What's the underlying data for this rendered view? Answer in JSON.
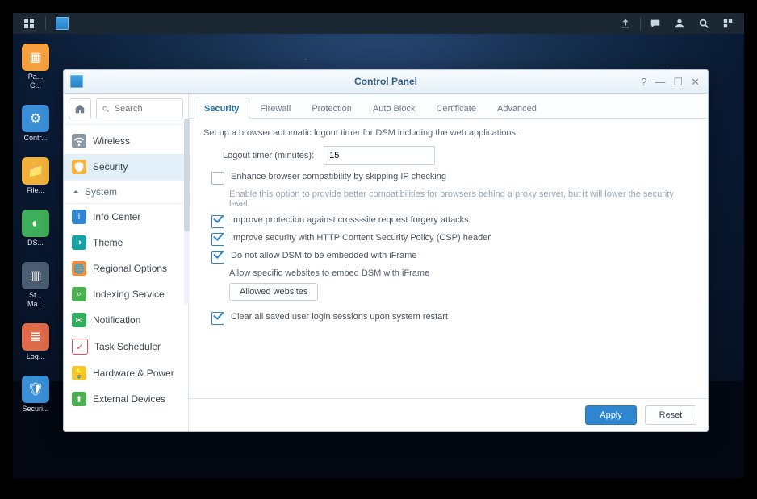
{
  "taskbar": {
    "right_icons": [
      "upload-icon",
      "chat-icon",
      "user-icon",
      "search-icon",
      "widgets-icon"
    ]
  },
  "dock": [
    {
      "label": "Pa...",
      "sub": "C...",
      "color": "#f59f3e"
    },
    {
      "label": "Contr...",
      "sub": "",
      "color": "#3b8fd6"
    },
    {
      "label": "File...",
      "sub": "",
      "color": "#f2b23a"
    },
    {
      "label": "DS...",
      "sub": "",
      "color": "#3fae5a"
    },
    {
      "label": "St...",
      "sub": "Ma...",
      "color": "#4a5d72"
    },
    {
      "label": "Log...",
      "sub": "",
      "color": "#e06b4a"
    },
    {
      "label": "Securi...",
      "sub": "",
      "color": "#3b8fd6"
    }
  ],
  "window": {
    "title": "Control Panel",
    "search_placeholder": "Search",
    "sidebar": {
      "items": [
        {
          "label": "Wireless",
          "color": "#8c97a4",
          "active": false
        },
        {
          "label": "Security",
          "color": "#f6b23b",
          "active": true
        }
      ],
      "group": "System",
      "system_items": [
        {
          "label": "Info Center",
          "color": "#2f86d0"
        },
        {
          "label": "Theme",
          "color": "#17a2a8"
        },
        {
          "label": "Regional Options",
          "color": "#f08c3a"
        },
        {
          "label": "Indexing Service",
          "color": "#4caf50"
        },
        {
          "label": "Notification",
          "color": "#2fae5b"
        },
        {
          "label": "Task Scheduler",
          "color": "#e84b4b"
        },
        {
          "label": "Hardware & Power",
          "color": "#f5c531"
        },
        {
          "label": "External Devices",
          "color": "#4caf50"
        }
      ]
    },
    "tabs": [
      {
        "label": "Security",
        "active": true
      },
      {
        "label": "Firewall",
        "active": false
      },
      {
        "label": "Protection",
        "active": false
      },
      {
        "label": "Auto Block",
        "active": false
      },
      {
        "label": "Certificate",
        "active": false
      },
      {
        "label": "Advanced",
        "active": false
      }
    ],
    "pane": {
      "intro": "Set up a browser automatic logout timer for DSM including the web applications.",
      "logout_label": "Logout timer (minutes):",
      "logout_value": "15",
      "opt_enhance": "Enhance browser compatibility by skipping IP checking",
      "opt_enhance_hint": "Enable this option to provide better compatibilities for browsers behind a proxy server, but it will lower the security level.",
      "opt_csrf": "Improve protection against cross-site request forgery attacks",
      "opt_csp": "Improve security with HTTP Content Security Policy (CSP) header",
      "opt_iframe": "Do not allow DSM to be embedded with iFrame",
      "opt_iframe_sub": "Allow specific websites to embed DSM with iFrame",
      "btn_allowed": "Allowed websites",
      "opt_clear": "Clear all saved user login sessions upon system restart"
    },
    "footer": {
      "apply": "Apply",
      "reset": "Reset"
    }
  }
}
